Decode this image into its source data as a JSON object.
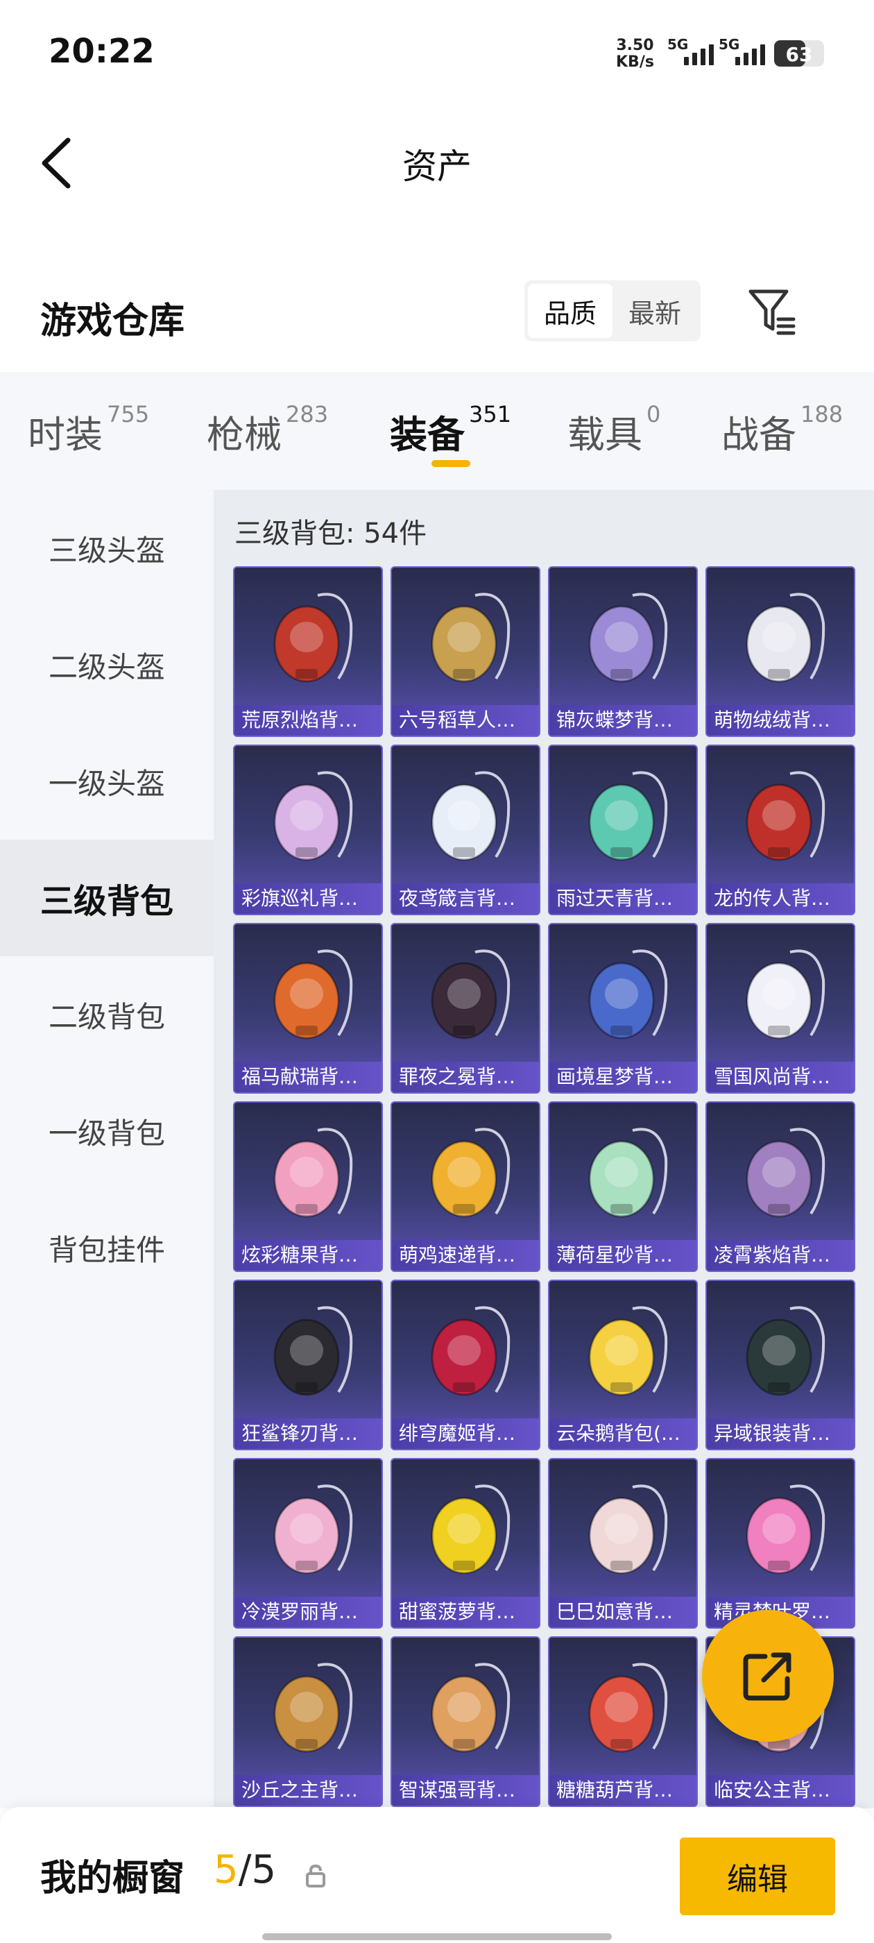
{
  "status_bar": {
    "time": "20:22",
    "net_speed": "3.50",
    "net_unit": "KB/s",
    "sim1": "5G",
    "sim2": "5G",
    "battery": "63",
    "battery_level": 0.63
  },
  "header": {
    "title": "资产"
  },
  "warehouse": {
    "title": "游戏仓库",
    "sort_options": [
      "品质",
      "最新"
    ],
    "sort_selected": "品质",
    "filter_icon": "filter-icon"
  },
  "tabs": [
    {
      "label": "时装",
      "count": "755"
    },
    {
      "label": "枪械",
      "count": "283"
    },
    {
      "label": "装备",
      "count": "351",
      "active": true
    },
    {
      "label": "载具",
      "count": "0"
    },
    {
      "label": "战备",
      "count": "188"
    }
  ],
  "sidebar": {
    "items": [
      "三级头盔",
      "二级头盔",
      "一级头盔",
      "三级背包",
      "二级背包",
      "一级背包",
      "背包挂件"
    ],
    "active": "三级背包"
  },
  "main": {
    "count_label": "三级背包: 54件",
    "items": [
      {
        "name": "荒原烈焰背…",
        "color": "#c0392b"
      },
      {
        "name": "六号稻草人…",
        "color": "#c8a050"
      },
      {
        "name": "锦灰蝶梦背…",
        "color": "#9b8bd6"
      },
      {
        "name": "萌物绒绒背…",
        "color": "#e8e8f0"
      },
      {
        "name": "彩旗巡礼背…",
        "color": "#d9b3e6"
      },
      {
        "name": "夜鸢箴言背…",
        "color": "#e8eef8"
      },
      {
        "name": "雨过天青背…",
        "color": "#5cc9b0"
      },
      {
        "name": "龙的传人背…",
        "color": "#c0302a"
      },
      {
        "name": "福马献瑞背…",
        "color": "#e06a2c"
      },
      {
        "name": "罪夜之冕背…",
        "color": "#3a2a3a"
      },
      {
        "name": "画境星梦背…",
        "color": "#4a6acb"
      },
      {
        "name": "雪国风尚背…",
        "color": "#f0f0f8"
      },
      {
        "name": "炫彩糖果背…",
        "color": "#f2a0c0"
      },
      {
        "name": "萌鸡速递背…",
        "color": "#f0b030"
      },
      {
        "name": "薄荷星砂背…",
        "color": "#a8e0c0"
      },
      {
        "name": "凌霄紫焰背…",
        "color": "#a080c0"
      },
      {
        "name": "狂鲨锋刃背…",
        "color": "#2a2a30"
      },
      {
        "name": "绯穹魔姬背…",
        "color": "#c02040"
      },
      {
        "name": "云朵鹅背包(…",
        "color": "#f5d040"
      },
      {
        "name": "异域银装背…",
        "color": "#2a3a3a"
      },
      {
        "name": "冷漠罗丽背…",
        "color": "#f0b0d0"
      },
      {
        "name": "甜蜜菠萝背…",
        "color": "#f0d020"
      },
      {
        "name": "巳巳如意背…",
        "color": "#f0d8d8"
      },
      {
        "name": "精灵梦叶罗…",
        "color": "#f080c0"
      },
      {
        "name": "沙丘之主背…",
        "color": "#c89040"
      },
      {
        "name": "智谋强哥背…",
        "color": "#e0a060"
      },
      {
        "name": "糖糖葫芦背…",
        "color": "#e05040"
      },
      {
        "name": "临安公主背…",
        "color": "#f2b3c0"
      }
    ]
  },
  "fab": {
    "icon": "share-icon"
  },
  "bottom": {
    "label": "我的橱窗",
    "current": "5",
    "separator": "/",
    "total": "5",
    "lock_icon": "lock-icon",
    "edit_label": "编辑"
  },
  "colors": {
    "accent": "#f5b400",
    "card_bg": "#3a3c70",
    "label_bg": "#5a48bd"
  }
}
